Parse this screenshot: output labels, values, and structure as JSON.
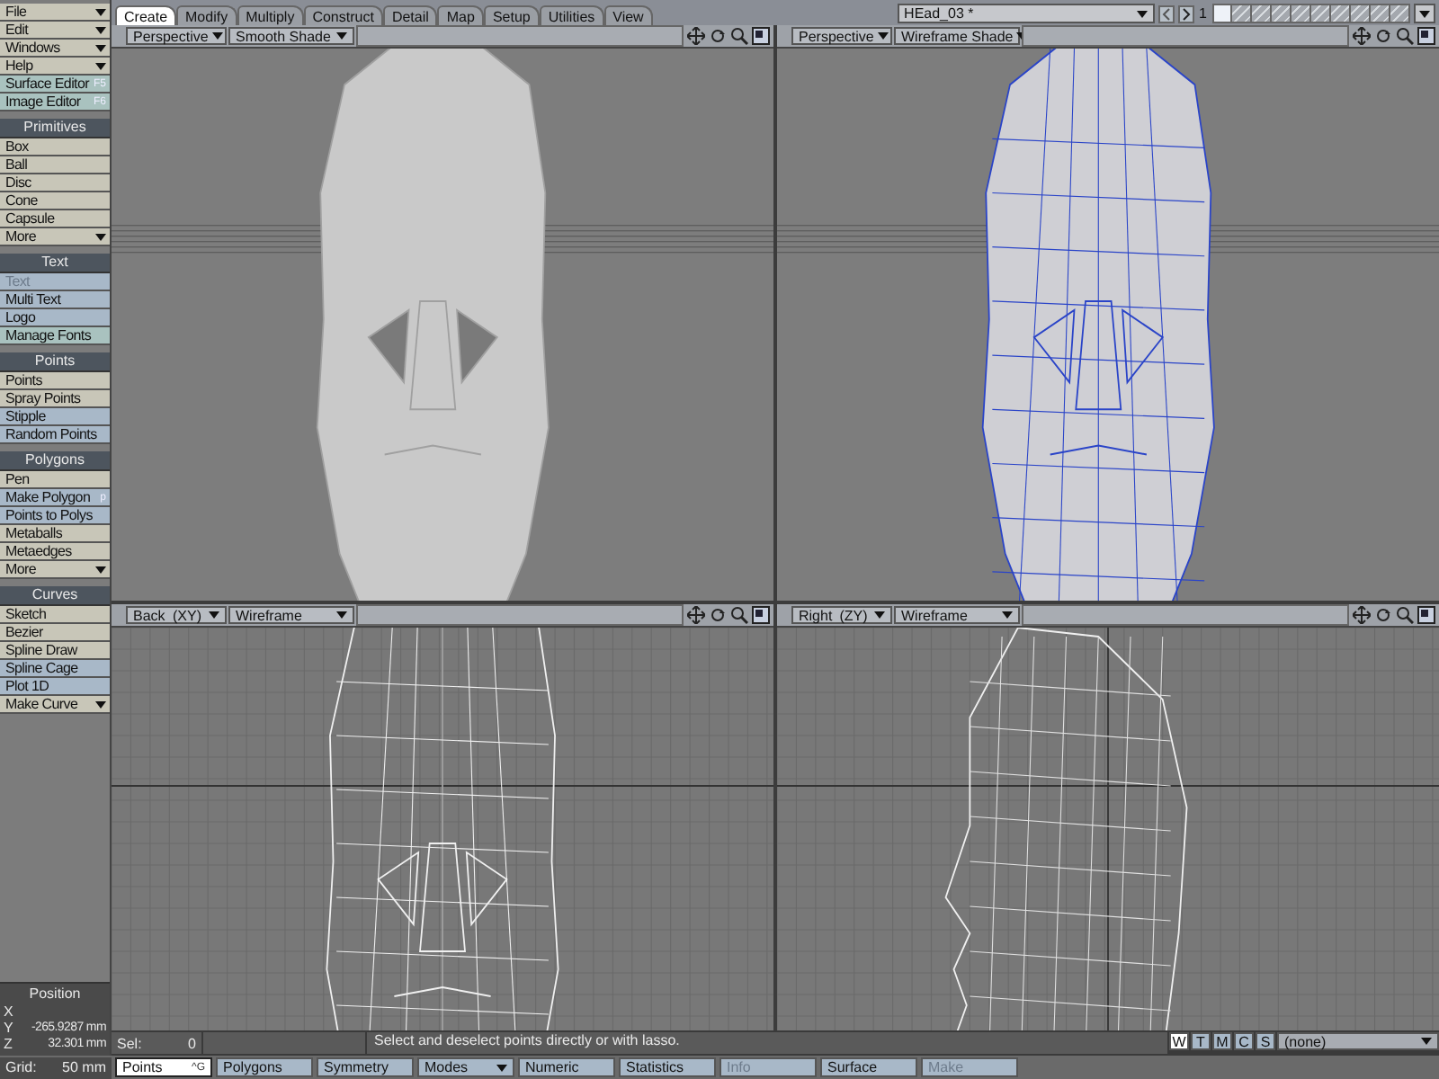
{
  "sidebar": {
    "groups": [
      {
        "items": [
          {
            "label": "File",
            "menu": true,
            "color": "#c8c6b8"
          },
          {
            "label": "Edit",
            "menu": true,
            "color": "#c8c6b8"
          },
          {
            "label": "Windows",
            "menu": true,
            "color": "#c8c6b8"
          },
          {
            "label": "Help",
            "menu": true,
            "color": "#c8c6b8"
          },
          {
            "label": "Surface Editor",
            "shortcut": "F5",
            "color": "#a9c2bf"
          },
          {
            "label": "Image Editor",
            "shortcut": "F6",
            "color": "#a9c2bf"
          }
        ]
      },
      {
        "title": "Primitives",
        "items": [
          {
            "label": "Box",
            "color": "#c8c6b8"
          },
          {
            "label": "Ball",
            "color": "#c8c6b8"
          },
          {
            "label": "Disc",
            "color": "#c8c6b8"
          },
          {
            "label": "Cone",
            "color": "#c8c6b8"
          },
          {
            "label": "Capsule",
            "color": "#c8c6b8"
          },
          {
            "label": "More",
            "menu": true,
            "color": "#c8c6b8"
          }
        ]
      },
      {
        "title": "Text",
        "items": [
          {
            "label": "Text",
            "disabled": true,
            "color": "#a8b8c8"
          },
          {
            "label": "Multi Text",
            "color": "#a8b8c8"
          },
          {
            "label": "Logo",
            "color": "#a8b8c8"
          },
          {
            "label": "Manage Fonts",
            "color": "#a9c2bf"
          }
        ]
      },
      {
        "title": "Points",
        "items": [
          {
            "label": "Points",
            "color": "#c8c6b8"
          },
          {
            "label": "Spray Points",
            "color": "#c8c6b8"
          },
          {
            "label": "Stipple",
            "color": "#a8b8c8"
          },
          {
            "label": "Random Points",
            "color": "#a8b8c8"
          }
        ]
      },
      {
        "title": "Polygons",
        "items": [
          {
            "label": "Pen",
            "color": "#c8c6b8"
          },
          {
            "label": "Make Polygon",
            "shortcut": "p",
            "color": "#a8b8c8"
          },
          {
            "label": "Points to Polys",
            "color": "#a8b8c8"
          },
          {
            "label": "Metaballs",
            "color": "#c8c6b8"
          },
          {
            "label": "Metaedges",
            "color": "#c8c6b8"
          },
          {
            "label": "More",
            "menu": true,
            "color": "#c8c6b8"
          }
        ]
      },
      {
        "title": "Curves",
        "items": [
          {
            "label": "Sketch",
            "color": "#c8c6b8"
          },
          {
            "label": "Bezier",
            "color": "#c8c6b8"
          },
          {
            "label": "Spline Draw",
            "color": "#c8c6b8"
          },
          {
            "label": "Spline Cage",
            "color": "#a8b8c8"
          },
          {
            "label": "Plot 1D",
            "color": "#a8b8c8"
          },
          {
            "label": "Make Curve",
            "menu": true,
            "color": "#c8c6b8"
          }
        ]
      }
    ],
    "position": {
      "title": "Position",
      "axes": [
        {
          "axis": "X"
        },
        {
          "axis": "Y",
          "value": "-265.9287 mm"
        },
        {
          "axis": "Z",
          "value": "32.301 mm"
        }
      ]
    }
  },
  "tabs": [
    {
      "label": "Create",
      "selected": true
    },
    {
      "label": "Modify",
      "selected": false
    },
    {
      "label": "Multiply",
      "selected": false
    },
    {
      "label": "Construct",
      "selected": false
    },
    {
      "label": "Detail",
      "selected": false
    },
    {
      "label": "Map",
      "selected": false
    },
    {
      "label": "Setup",
      "selected": false
    },
    {
      "label": "Utilities",
      "selected": false
    },
    {
      "label": "View",
      "selected": false
    }
  ],
  "object": {
    "name": "HEad_03 *",
    "layer_number": "1",
    "layers": [
      {
        "selected": true
      },
      {
        "selected": false
      },
      {
        "selected": false
      },
      {
        "selected": false
      },
      {
        "selected": false
      },
      {
        "selected": false
      },
      {
        "selected": false
      },
      {
        "selected": false
      },
      {
        "selected": false
      },
      {
        "selected": false
      }
    ]
  },
  "viewports": [
    {
      "view": "Perspective",
      "shading": "Smooth Shade",
      "kind": "shaded"
    },
    {
      "view": "Perspective",
      "shading": "Wireframe Shade",
      "kind": "wireshaded"
    },
    {
      "view": "Back",
      "axes": "(XY)",
      "shading": "Wireframe",
      "kind": "front"
    },
    {
      "view": "Right",
      "axes": "(ZY)",
      "shading": "Wireframe",
      "kind": "side"
    }
  ],
  "status": {
    "sel_label": "Sel:",
    "sel_value": "0",
    "message": "Select and deselect points directly or with lasso.",
    "modes": [
      {
        "label": "W",
        "selected": true
      },
      {
        "label": "T",
        "selected": false
      },
      {
        "label": "M",
        "selected": false
      },
      {
        "label": "C",
        "selected": false
      },
      {
        "label": "S",
        "selected": false
      }
    ],
    "surface": "(none)"
  },
  "bottom": {
    "grid_label": "Grid:",
    "grid_value": "50 mm",
    "buttons": [
      {
        "label": "Points",
        "shortcut": "^G",
        "selected": true,
        "color": "#ffffff"
      },
      {
        "label": "Polygons",
        "selected": false,
        "color": "#a8b8c8"
      },
      {
        "label": "Symmetry",
        "selected": false,
        "color": "#a8b8c8"
      },
      {
        "label": "Modes",
        "menu": true,
        "selected": false,
        "color": "#a8b8c8"
      },
      {
        "label": "Numeric",
        "selected": false,
        "color": "#a8b8c8"
      },
      {
        "label": "Statistics",
        "selected": false,
        "color": "#a8b8c8"
      },
      {
        "label": "Info",
        "disabled": true,
        "selected": false,
        "color": "#a8b8c8"
      },
      {
        "label": "Surface",
        "selected": false,
        "color": "#a8b8c8"
      },
      {
        "label": "Make",
        "disabled": true,
        "selected": false,
        "color": "#a8b8c8"
      }
    ]
  }
}
